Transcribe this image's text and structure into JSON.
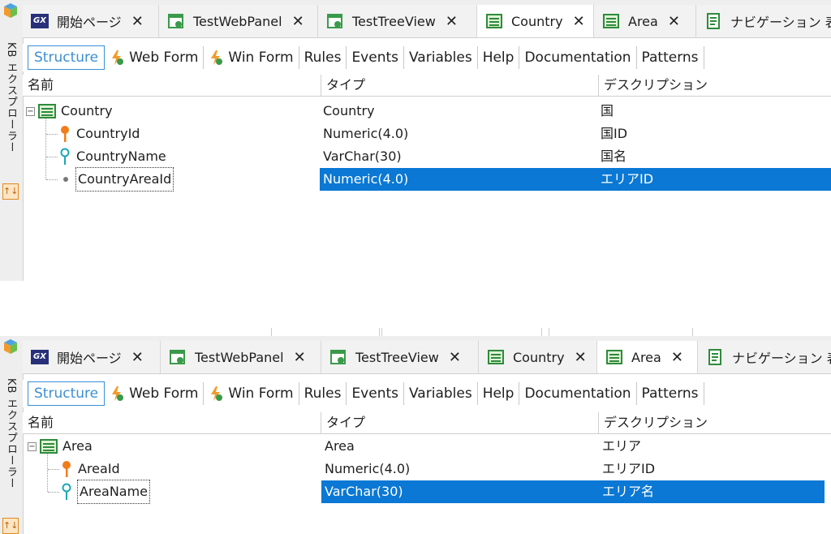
{
  "sidebar": {
    "label": "KB エクスプローラー"
  },
  "tabs": [
    {
      "label": "開始ページ",
      "icon": "gx-logo-icon"
    },
    {
      "label": "TestWebPanel",
      "icon": "web-panel-icon"
    },
    {
      "label": "TestTreeView",
      "icon": "web-panel-icon"
    },
    {
      "label": "Country",
      "icon": "transaction-icon"
    },
    {
      "label": "Area",
      "icon": "transaction-icon"
    },
    {
      "label": "ナビゲーション 表示",
      "icon": "navigation-report-icon"
    }
  ],
  "tab_truncated": {
    "top": "ナビゲーション 表示",
    "bottom": "ナビゲーション 表"
  },
  "toolbar": [
    {
      "label": "Structure"
    },
    {
      "label": "Web Form",
      "icon": "web-form-bolt-icon"
    },
    {
      "label": "Win Form",
      "icon": "win-form-bolt-icon"
    },
    {
      "label": "Rules"
    },
    {
      "label": "Events"
    },
    {
      "label": "Variables"
    },
    {
      "label": "Help"
    },
    {
      "label": "Documentation"
    },
    {
      "label": "Patterns"
    }
  ],
  "columns": {
    "name": "名前",
    "type": "タイプ",
    "description": "デスクリプション"
  },
  "top": {
    "active_tab": "Country",
    "rows": [
      {
        "name": "Country",
        "type": "Country",
        "description": "国",
        "kind": "root"
      },
      {
        "name": "CountryId",
        "type": "Numeric(4.0)",
        "description": "国ID",
        "kind": "primary-key"
      },
      {
        "name": "CountryName",
        "type": "VarChar(30)",
        "description": "国名",
        "kind": "candidate-key"
      },
      {
        "name": "CountryAreaId",
        "type": "Numeric(4.0)",
        "description": "エリアID",
        "kind": "attribute",
        "selected": true
      }
    ]
  },
  "bottom": {
    "active_tab": "Area",
    "rows": [
      {
        "name": "Area",
        "type": "Area",
        "description": "エリア",
        "kind": "root"
      },
      {
        "name": "AreaId",
        "type": "Numeric(4.0)",
        "description": "エリアID",
        "kind": "primary-key"
      },
      {
        "name": "AreaName",
        "type": "VarChar(30)",
        "description": "エリア名",
        "kind": "candidate-key",
        "selected": true
      }
    ]
  },
  "colors": {
    "selection": "#0a78d4",
    "accent": "#3b8fd6",
    "key_orange": "#f07d1a",
    "key_teal": "#1aa7b8"
  }
}
